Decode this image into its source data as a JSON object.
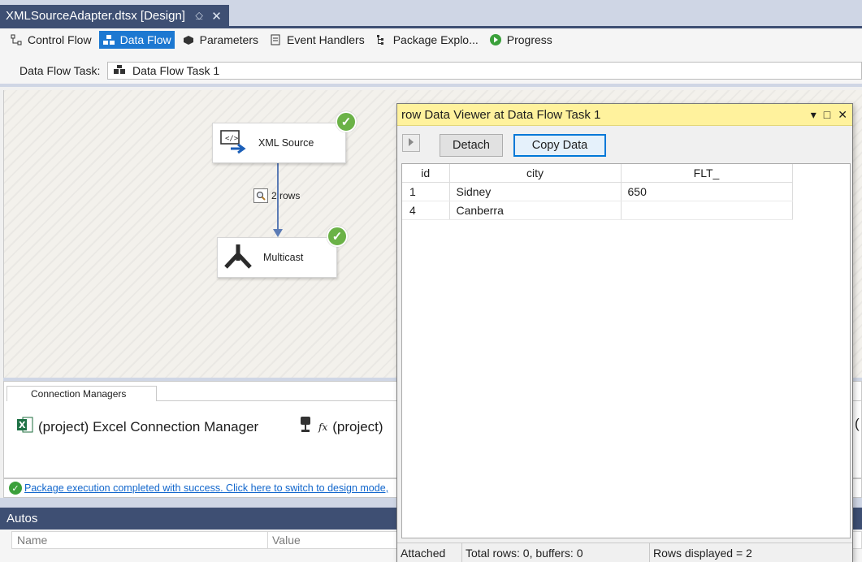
{
  "document_tab": {
    "title": "XMLSourceAdapter.dtsx [Design]",
    "pin_icon": "pin-icon",
    "close_icon": "close-icon"
  },
  "designer_tabs": [
    {
      "label": "Control Flow",
      "icon": "control-flow-icon",
      "active": false
    },
    {
      "label": "Data Flow",
      "icon": "data-flow-icon",
      "active": true
    },
    {
      "label": "Parameters",
      "icon": "parameters-icon",
      "active": false
    },
    {
      "label": "Event Handlers",
      "icon": "event-handlers-icon",
      "active": false
    },
    {
      "label": "Package Explo...",
      "icon": "package-explorer-icon",
      "active": false
    },
    {
      "label": "Progress",
      "icon": "progress-icon",
      "active": false
    }
  ],
  "data_flow_task": {
    "label": "Data Flow Task:",
    "value": "Data Flow Task 1"
  },
  "canvas": {
    "components": [
      {
        "name": "XML Source",
        "status": "success"
      },
      {
        "name": "Multicast",
        "status": "success"
      }
    ],
    "path_label": "2 rows"
  },
  "connection_managers": {
    "tab_label": "Connection Managers",
    "items": [
      "(project) Excel Connection Manager",
      "(project)"
    ],
    "overflow": "("
  },
  "status_message": "Package execution completed with success. Click here to switch to design mode,",
  "autos": {
    "title": "Autos",
    "columns": [
      "Name",
      "Value"
    ]
  },
  "data_viewer": {
    "title": "row Data Viewer at Data Flow Task 1",
    "buttons": {
      "detach": "Detach",
      "copy": "Copy Data"
    },
    "columns": [
      "id",
      "city",
      "FLT_"
    ],
    "rows": [
      [
        "1",
        "Sidney",
        "650"
      ],
      [
        "4",
        "Canberra",
        ""
      ]
    ],
    "status": {
      "state": "Attached",
      "totals": "Total rows: 0, buffers: 0",
      "displayed": "Rows displayed = 2"
    }
  },
  "colors": {
    "accent": "#1c78d1",
    "title_bar": "#3e4f73",
    "viewer_title": "#fff29d",
    "success": "#6bb247"
  }
}
